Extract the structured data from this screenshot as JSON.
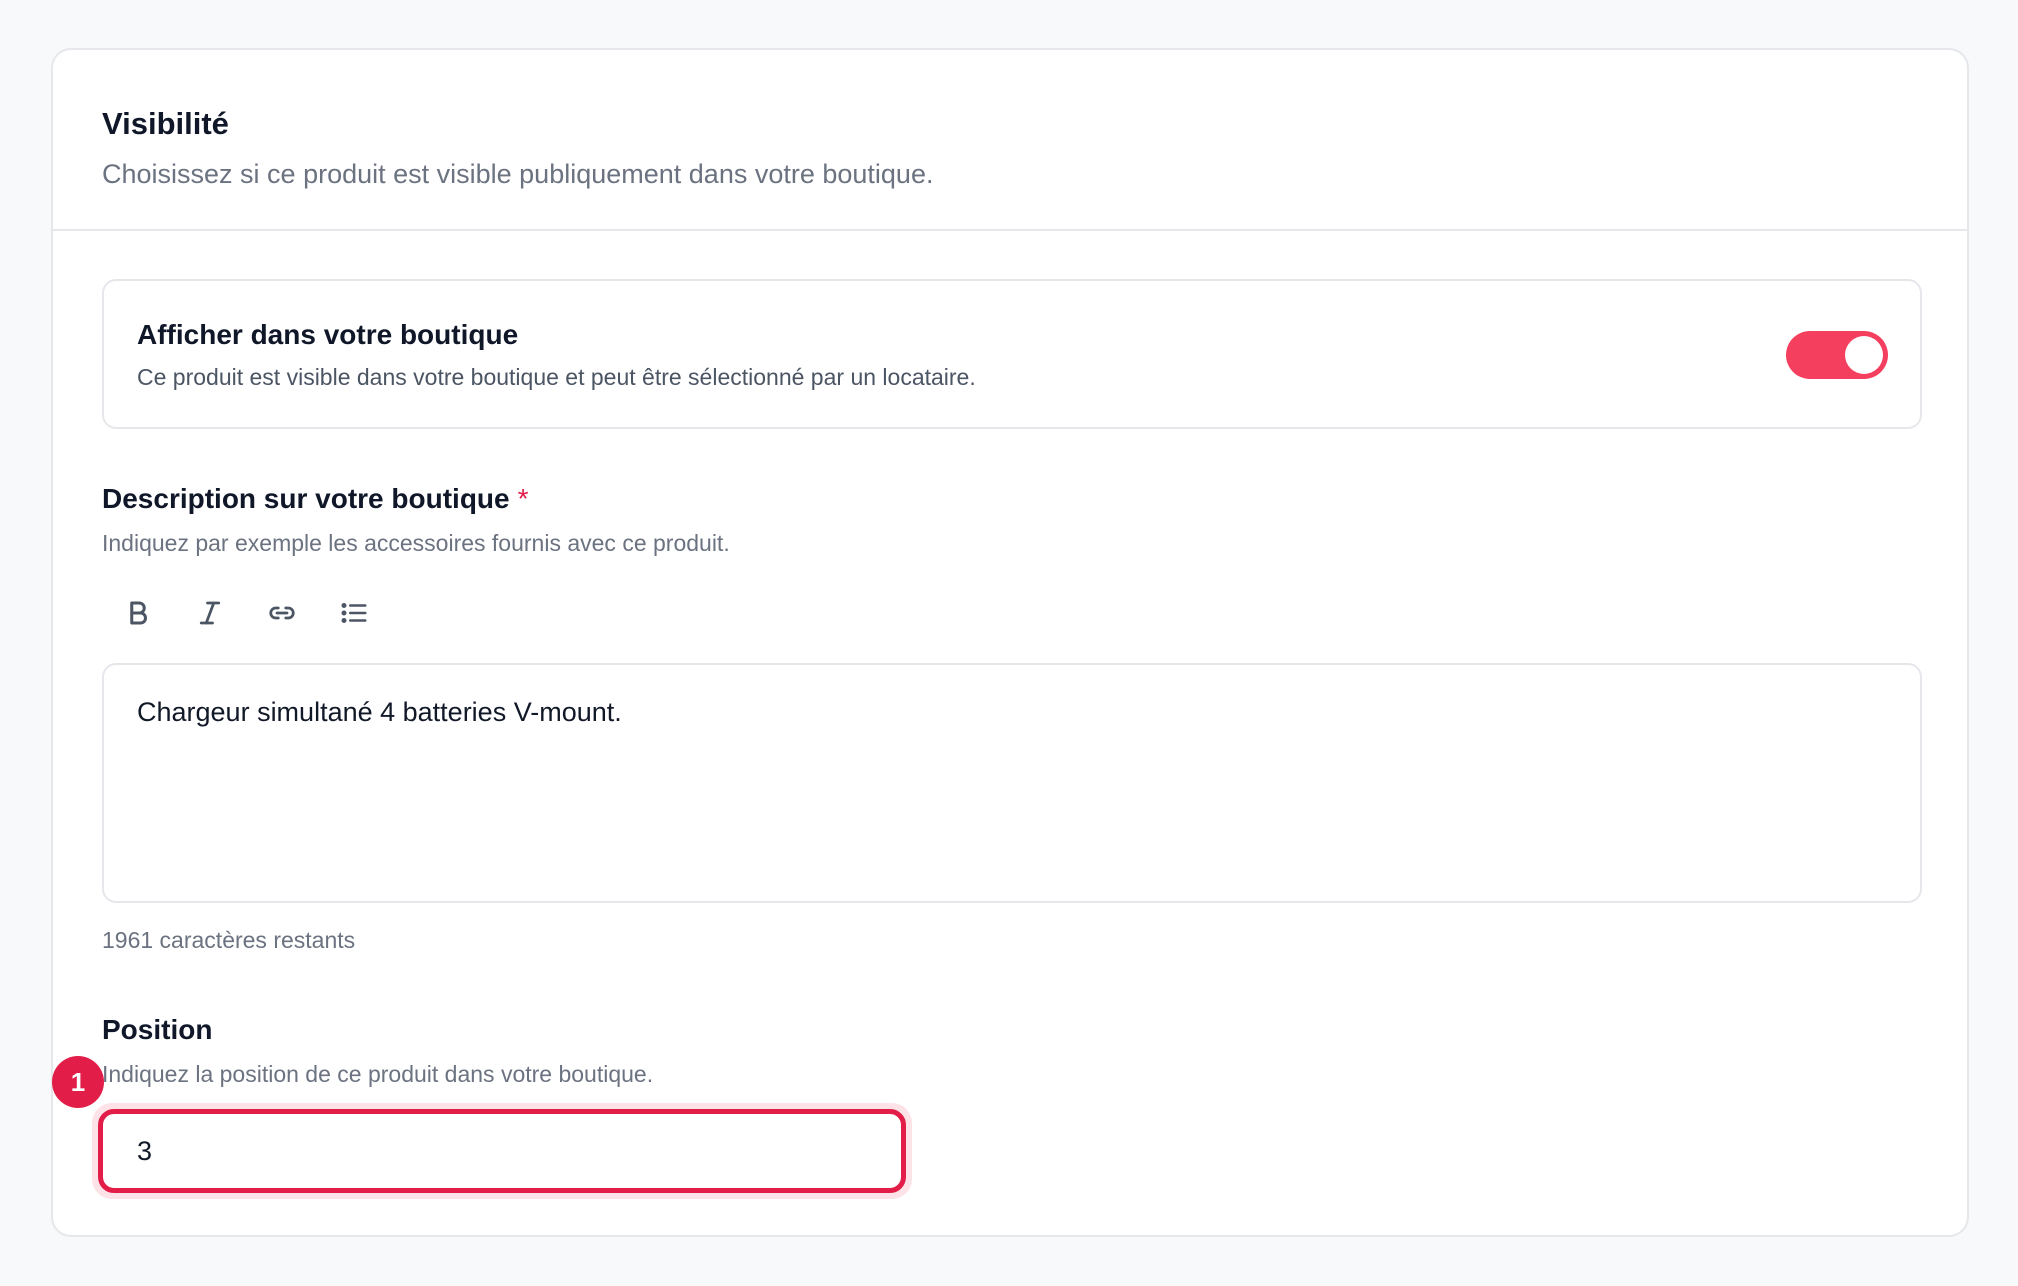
{
  "section": {
    "title": "Visibilité",
    "subtitle": "Choisissez si ce produit est visible publiquement dans votre boutique."
  },
  "shop_toggle": {
    "title": "Afficher dans votre boutique",
    "description": "Ce produit est visible dans votre boutique et peut être sélectionné par un locataire.",
    "enabled": true,
    "color": "#f43f5e"
  },
  "description_field": {
    "label": "Description sur votre boutique",
    "required_mark": "*",
    "help": "Indiquez par exemple les accessoires fournis avec ce produit.",
    "toolbar": [
      "bold-icon",
      "italic-icon",
      "link-icon",
      "list-icon"
    ],
    "content": "Chargeur simultané 4 batteries V-mount.",
    "counter": "1961 caractères restants"
  },
  "position_field": {
    "label": "Position",
    "help": "Indiquez la position de ce produit dans votre boutique.",
    "value": "3",
    "badge": "1",
    "highlight_color": "#e11d48"
  }
}
